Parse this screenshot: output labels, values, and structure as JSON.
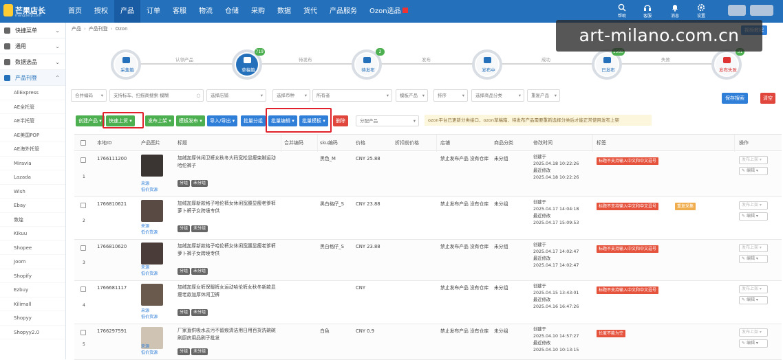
{
  "app": {
    "logo_title": "芒果店长",
    "logo_sub": "mangoerp.com"
  },
  "nav": [
    "首页",
    "授权",
    "产品",
    "订单",
    "客服",
    "物流",
    "仓储",
    "采购",
    "数据",
    "货代",
    "产品服务",
    "Ozon选品"
  ],
  "tools": [
    "帮助",
    "客服",
    "消息",
    "设置"
  ],
  "sidebar": {
    "sections": [
      "快捷菜单",
      "通用",
      "数据选品",
      "产品刊登"
    ],
    "items": [
      "AliExpress",
      "AE全托管",
      "AE半托管",
      "AE美国POP",
      "AE海外托管",
      "Miravia",
      "Lazada",
      "Wish",
      "Ebay",
      "敦煌",
      "Kikuu",
      "Shopee",
      "Joom",
      "Shopify",
      "Ezbuy",
      "Kilimall",
      "Shopyy",
      "Shopyy2.0"
    ]
  },
  "breadcrumb": [
    "产品",
    "产品刊登",
    "Ozon"
  ],
  "help_btn": "视频教程",
  "steps": [
    {
      "label": "采集箱",
      "badge": ""
    },
    {
      "label": "草稿箱",
      "badge": "719"
    },
    {
      "label": "待发布",
      "badge": "2"
    },
    {
      "label": "发布中",
      "badge": ""
    },
    {
      "label": "已发布",
      "badge": "1580"
    },
    {
      "label": "发布失败",
      "badge": "31"
    }
  ],
  "step_links": [
    "认领产品",
    "待发布",
    "发布",
    "成功",
    "失败"
  ],
  "filters": {
    "sku": "合并编码",
    "search_ph": "支持标车、扫描商搜索",
    "mode": "模糊",
    "store": "选择店铺",
    "attr": "选择币种",
    "owner": "所有者",
    "tmpl": "模板产品",
    "sort": "排序",
    "cat": "选择商品分类",
    "dup": "重复产品",
    "save": "保存搜索",
    "clear": "清空"
  },
  "actions": [
    "创建产品",
    "快速上货",
    "发布上架",
    "模板发布",
    "导入/导出",
    "批量分组",
    "批量编辑",
    "批量模板",
    "删除"
  ],
  "group_ph": "分配产品",
  "notice": "ozon平台已更新分类接口，ozon草稿箱、待发布产品需要重新选择分类后才能正常使用发布上架",
  "headers": [
    "本地ID",
    "产品图片",
    "标题",
    "合并编码",
    "sku编码",
    "价格",
    "折扣前价格",
    "店铺",
    "商品分类",
    "修改时间",
    "标签",
    "操作"
  ],
  "rows": [
    {
      "idx": "1",
      "id": "1766111200",
      "title": "加绒加厚休闲卫裤女秋冬大码宽松显瘦束脚运动哈伦裤子",
      "sku": "黑色_M",
      "price": "CNY 25.88",
      "store": "禁止发布产品 没有仓库",
      "cat": "未分组",
      "created": "创建于",
      "ctime": "2025.04.18 10:22:26",
      "modified": "最近修改",
      "mtime": "2025.04.18 10:22:26",
      "label": "标题不支持输入中文和中文逗号",
      "label2": ""
    },
    {
      "idx": "2",
      "id": "1766810621",
      "title": "加绒加厚新款格子哈伦裤女休闲宽腰显瘦老爹裤萝卜裤子女跨境专供",
      "sku": "黑白格仔_S",
      "price": "CNY 23.88",
      "store": "禁止发布产品 没有仓库",
      "cat": "未分组",
      "created": "创建于",
      "ctime": "2025.04.17 14:04:18",
      "modified": "最近修改",
      "mtime": "2025.04.17 15:09:53",
      "label": "标题不支持输入中文和中文逗号",
      "label2": "重复采集"
    },
    {
      "idx": "3",
      "id": "1766810620",
      "title": "加绒加厚新款格子哈伦裤女休闲宽腰显瘦老爹裤萝卜裤子女跨境专供",
      "sku": "黑白格仔_S",
      "price": "CNY 23.88",
      "store": "禁止发布产品 没有仓库",
      "cat": "未分组",
      "created": "创建于",
      "ctime": "2025.04.17 14:02:47",
      "modified": "最近修改",
      "mtime": "2025.04.17 14:02:47",
      "label": "标题不支持输入中文和中文逗号",
      "label2": ""
    },
    {
      "idx": "4",
      "id": "1766681117",
      "title": "加绒加厚女裤保暖裤女运动哈伦裤女秋冬新款显瘦老款加厚休闲卫裤",
      "sku": "",
      "price": "CNY",
      "store": "禁止发布产品 没有仓库",
      "cat": "未分组",
      "created": "创建于",
      "ctime": "2025.04.15 13:43:01",
      "modified": "最近修改",
      "mtime": "2025.04.16 16:47:26",
      "label": "标题不支持输入中文和中文逗号",
      "label2": ""
    },
    {
      "idx": "5",
      "id": "1766297591",
      "title": "厂家直供吸水去污不留痕清洁用日用百货洗碗碗刷厨房用品刷子批发",
      "sku": "白色",
      "price": "CNY 0.9",
      "store": "禁止发布产品 没有仓库",
      "cat": "未分组",
      "created": "创建于",
      "ctime": "2025.04.10 14:57:27",
      "modified": "最近修改",
      "mtime": "2025.04.10 10:13:15",
      "label": "长度不能为空",
      "label2": ""
    }
  ],
  "row_tags": [
    "分组",
    "未分组"
  ],
  "src_link": "来源",
  "src_link2": "低价货源",
  "op_publish": "发布上架",
  "op_edit": "编辑",
  "watermark": "art-milano.com.cn",
  "colors": {
    "topbar": "#2470ba",
    "green": "#4caf50",
    "blue": "#2f7ed8",
    "red": "#e0463c"
  }
}
